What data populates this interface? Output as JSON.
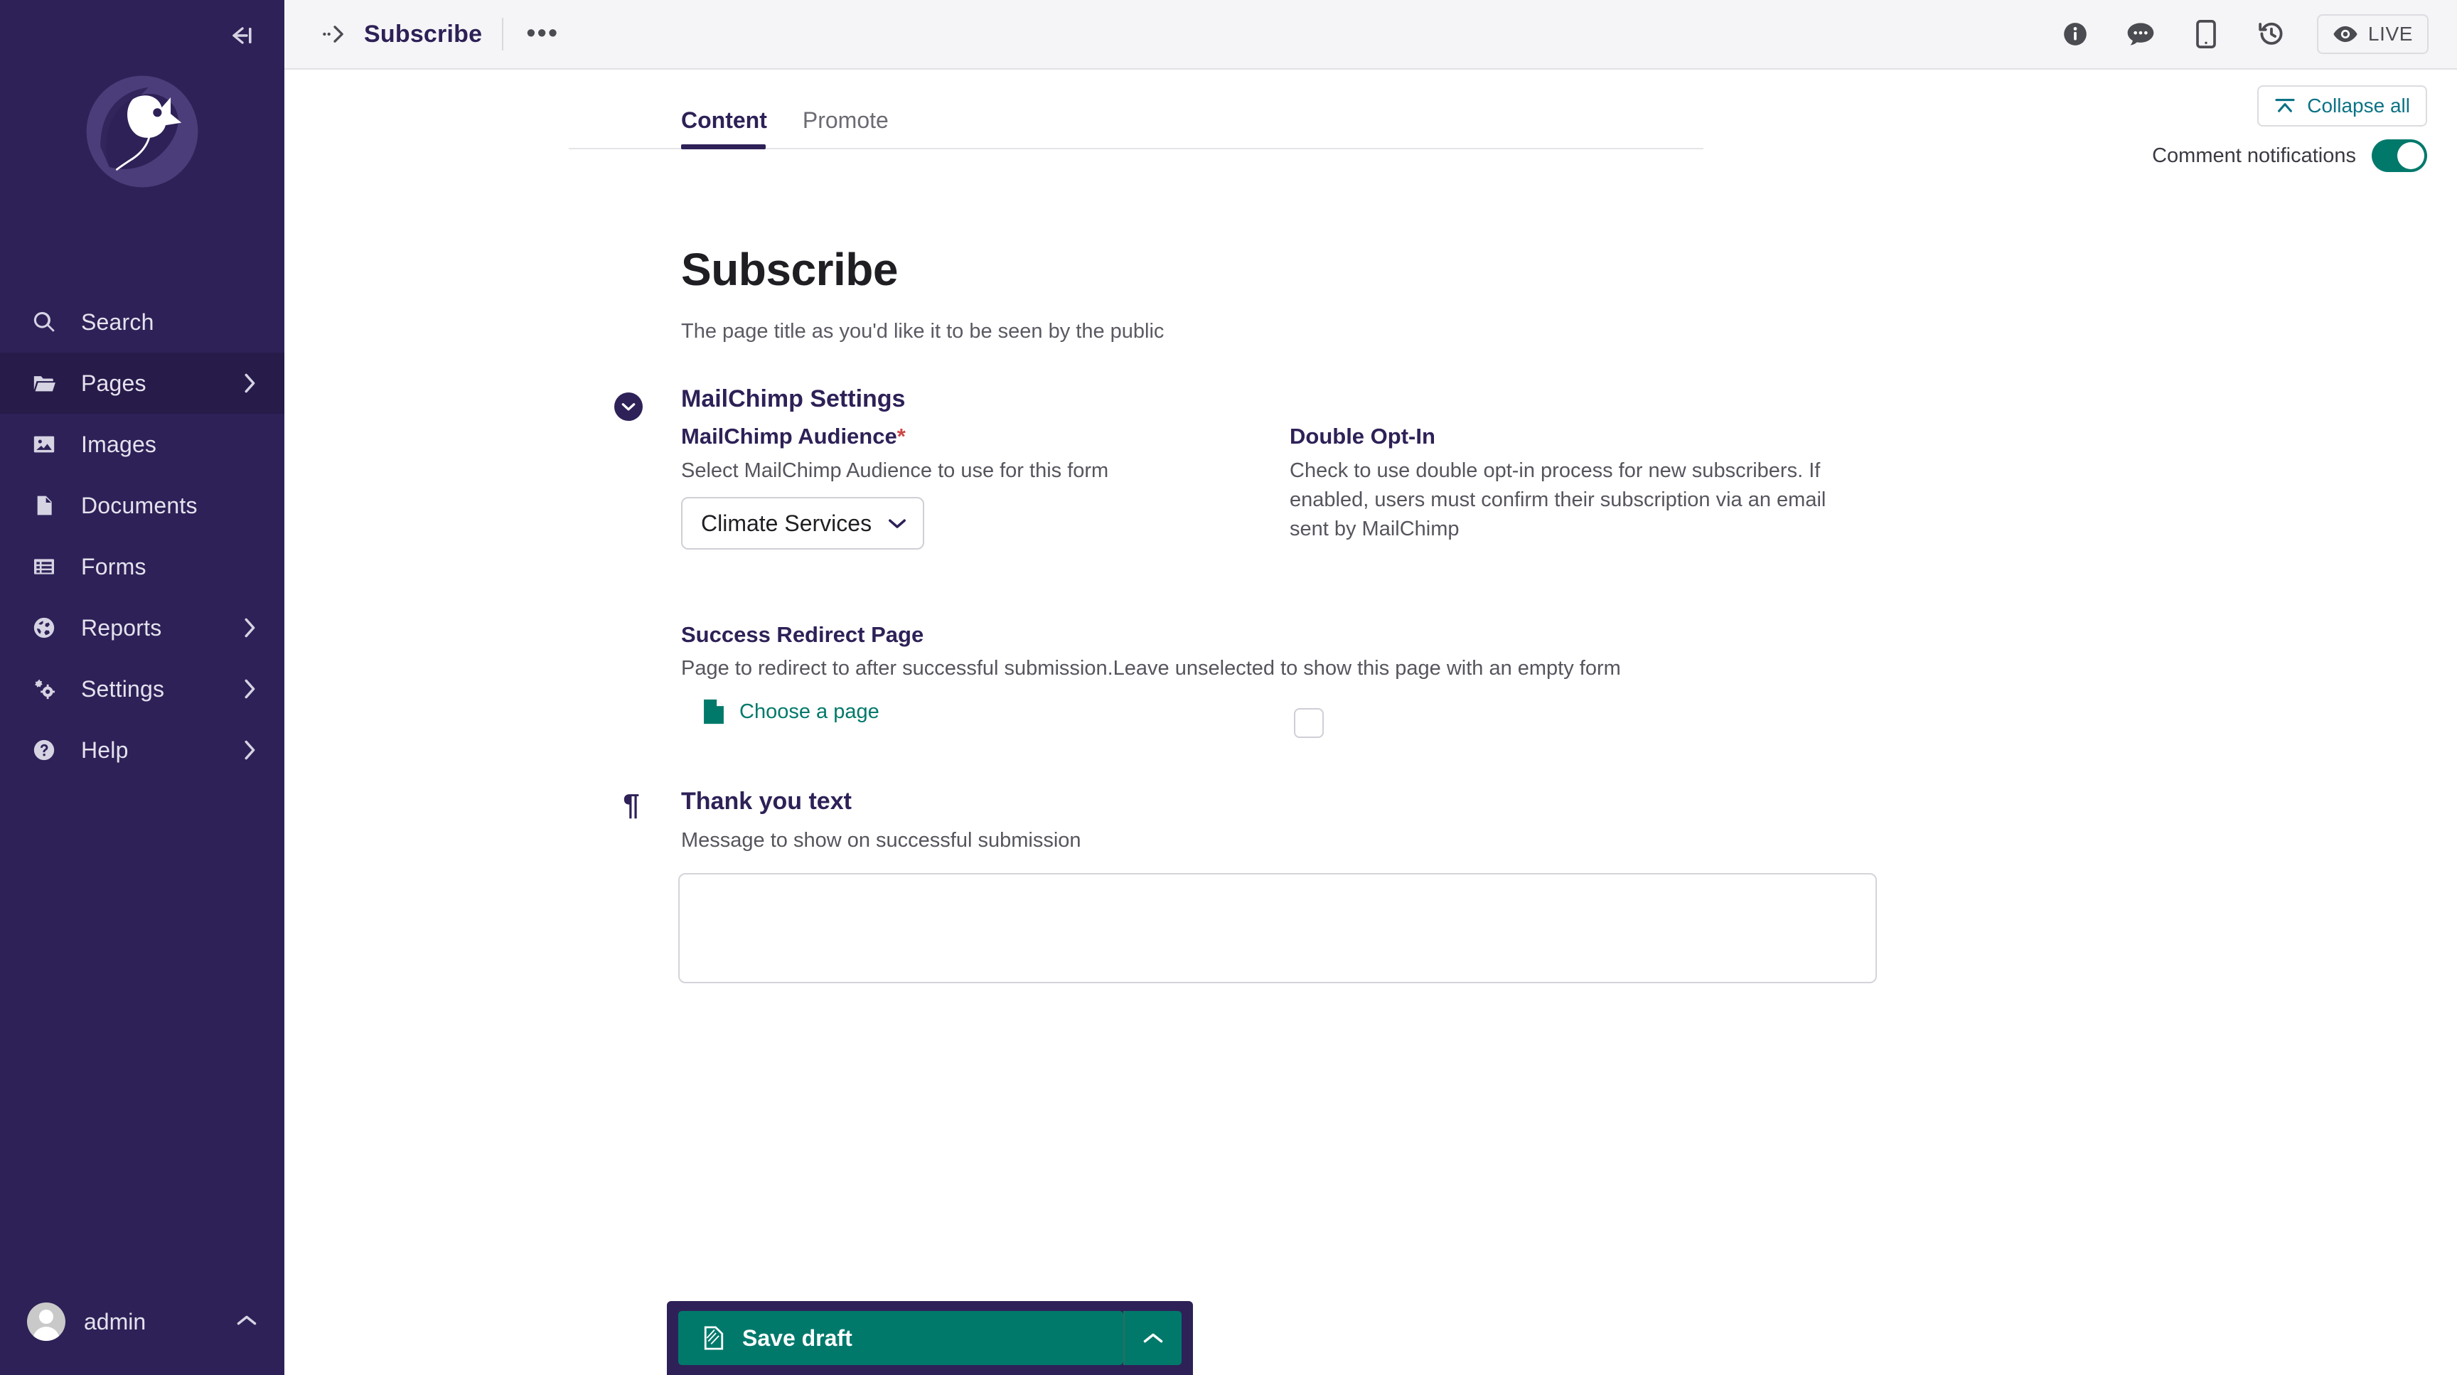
{
  "sidebar": {
    "collapse_icon": "collapse-sidebar-icon",
    "logo": "wagtail-bird-logo",
    "items": [
      {
        "label": "Search",
        "icon": "search-icon",
        "has_chevron": false,
        "active": false
      },
      {
        "label": "Pages",
        "icon": "folder-open-icon",
        "has_chevron": true,
        "active": true
      },
      {
        "label": "Images",
        "icon": "image-icon",
        "has_chevron": false,
        "active": false
      },
      {
        "label": "Documents",
        "icon": "document-icon",
        "has_chevron": false,
        "active": false
      },
      {
        "label": "Forms",
        "icon": "form-list-icon",
        "has_chevron": false,
        "active": false
      },
      {
        "label": "Reports",
        "icon": "globe-icon",
        "has_chevron": true,
        "active": false
      },
      {
        "label": "Settings",
        "icon": "cogs-icon",
        "has_chevron": true,
        "active": false
      },
      {
        "label": "Help",
        "icon": "help-circle-icon",
        "has_chevron": true,
        "active": false
      }
    ],
    "account": {
      "name": "admin",
      "avatar": "user-avatar",
      "chevron": "chevron-up-icon"
    }
  },
  "topbar": {
    "breadcrumb_toggle": "breadcrumb-expand-icon",
    "title": "Subscribe",
    "more_label": "•••",
    "actions": [
      {
        "name": "info-icon",
        "label": "Info"
      },
      {
        "name": "comments-icon",
        "label": "Comments"
      },
      {
        "name": "mobile-preview-icon",
        "label": "Preview"
      },
      {
        "name": "history-icon",
        "label": "History"
      }
    ],
    "status": {
      "label": "LIVE",
      "icon": "eye-icon"
    }
  },
  "tabs": [
    {
      "label": "Content",
      "active": true
    },
    {
      "label": "Promote",
      "active": false
    }
  ],
  "toolbar": {
    "collapse_all_label": "Collapse all",
    "collapse_all_icon": "collapse-up-icon",
    "comment_notifications_label": "Comment notifications",
    "comment_notifications_on": true
  },
  "page": {
    "heading": "Subscribe",
    "heading_help": "The page title as you'd like it to be seen by the public"
  },
  "mailchimp_panel": {
    "title": "MailChimp Settings",
    "toggle_icon": "chevron-down-circle-icon",
    "audience": {
      "label": "MailChimp Audience",
      "required_marker": "*",
      "help": "Select MailChimp Audience to use for this form",
      "selected": "Climate Services",
      "chevron": "chevron-down-icon"
    },
    "double_optin": {
      "label": "Double Opt-In",
      "help": "Check to use double opt-in process for new subscribers. If enabled, users must confirm their subscription via an email sent by MailChimp",
      "checked": false
    },
    "success_redirect": {
      "label": "Success Redirect Page",
      "help": "Page to redirect to after successful submission.Leave unselected to show this page with an empty form",
      "chooser_label": "Choose a page",
      "chooser_icon": "document-icon"
    }
  },
  "thankyou_panel": {
    "icon": "pilcrow-icon",
    "title": "Thank you text",
    "help": "Message to show on successful submission",
    "value": "",
    "placeholder": ""
  },
  "footer": {
    "save_label": "Save draft",
    "save_icon": "draft-document-icon",
    "more_icon": "chevron-up-icon"
  },
  "colors": {
    "sidebar_bg": "#2E2157",
    "accent_purple": "#2E2157",
    "accent_teal": "#00796B",
    "link_teal": "#0b7285",
    "required_red": "#cd4747"
  }
}
